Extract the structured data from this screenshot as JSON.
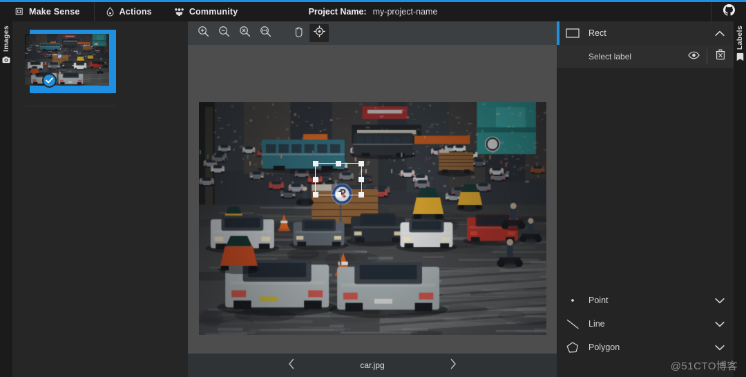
{
  "navbar": {
    "brand": "Make Sense",
    "brand_icon": "square-stack-icon",
    "items": [
      {
        "label": "Actions",
        "icon": "flame-icon"
      },
      {
        "label": "Community",
        "icon": "people-group-icon"
      }
    ],
    "project_label": "Project Name:",
    "project_value": "my-project-name",
    "github_icon": "github-icon"
  },
  "left_panel": {
    "tab_label": "Images",
    "tab_icon": "camera-icon",
    "selected_badge_icon": "check-icon",
    "thumbnail_alt": "car.jpg"
  },
  "toolbar": {
    "buttons": [
      {
        "name": "zoom-in-icon",
        "label": "Zoom in",
        "active": false
      },
      {
        "name": "zoom-out-icon",
        "label": "Zoom out",
        "active": false
      },
      {
        "name": "zoom-reset-icon",
        "label": "Zoom reset",
        "active": false
      },
      {
        "name": "zoom-fit-icon",
        "label": "Fit image",
        "active": false
      },
      {
        "name": "hand-pan-icon",
        "label": "Pan",
        "active": false
      },
      {
        "name": "crosshair-target-icon",
        "label": "Select",
        "active": true
      }
    ]
  },
  "canvas": {
    "annotation": {
      "shape": "rect",
      "handles": 8
    }
  },
  "bottom_bar": {
    "prev_icon": "chevron-left-icon",
    "next_icon": "chevron-right-icon",
    "filename": "car.jpg"
  },
  "right_panel": {
    "tab_label": "Labels",
    "tab_icon": "tag-icon",
    "sections": [
      {
        "title": "Rect",
        "icon": "rectangle-icon",
        "chevron": "chevron-up-icon",
        "expanded": true,
        "rows": [
          {
            "text": "Select label",
            "eye_icon": "eye-icon",
            "delete_icon": "trash-icon"
          }
        ]
      },
      {
        "title": "Point",
        "icon": "point-icon",
        "chevron": "chevron-down-icon",
        "expanded": false,
        "rows": []
      },
      {
        "title": "Line",
        "icon": "line-icon",
        "chevron": "chevron-down-icon",
        "expanded": false,
        "rows": []
      },
      {
        "title": "Polygon",
        "icon": "polygon-icon",
        "chevron": "chevron-down-icon",
        "expanded": false,
        "rows": []
      }
    ]
  },
  "watermark": {
    "text": "@51CTO博客"
  },
  "colors": {
    "accent": "#1e8fe1",
    "navbar_bg": "#1b1b1b",
    "panel_bg": "#242424",
    "canvas_bg": "#4d4d4d",
    "toolbar_bg": "#3b3f42",
    "bottom_bar_bg": "#2f3335"
  }
}
